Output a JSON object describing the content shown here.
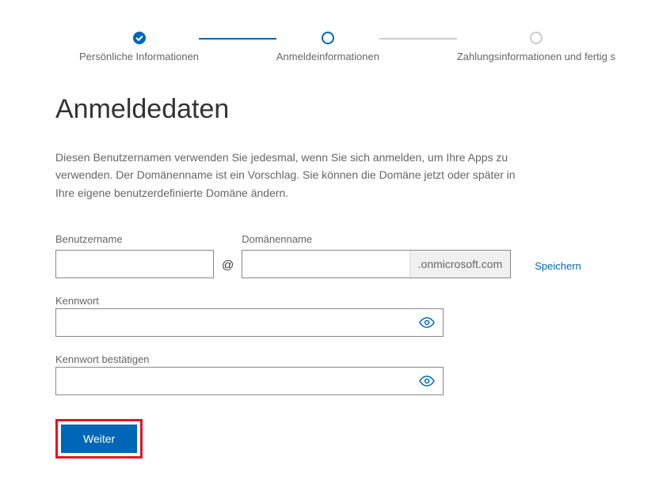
{
  "stepper": {
    "steps": [
      {
        "label": "Persönliche Informationen",
        "state": "completed"
      },
      {
        "label": "Anmeldeinformationen",
        "state": "current"
      },
      {
        "label": "Zahlungsinformationen und fertig s",
        "state": "pending"
      }
    ]
  },
  "page": {
    "title": "Anmeldedaten",
    "description": "Diesen Benutzernamen verwenden Sie jedesmal, wenn Sie sich anmelden, um Ihre Apps zu verwenden. Der Domänenname ist ein Vorschlag. Sie können die Domäne jetzt oder später in Ihre eigene benutzerdefinierte Domäne ändern."
  },
  "form": {
    "username": {
      "label": "Benutzername",
      "value": ""
    },
    "at_sign": "@",
    "domain": {
      "label": "Domänenname",
      "value": "",
      "suffix": ".onmicrosoft.com"
    },
    "save_link": "Speichern",
    "password": {
      "label": "Kennwort",
      "value": ""
    },
    "password_confirm": {
      "label": "Kennwort bestätigen",
      "value": ""
    },
    "next_button": "Weiter"
  }
}
